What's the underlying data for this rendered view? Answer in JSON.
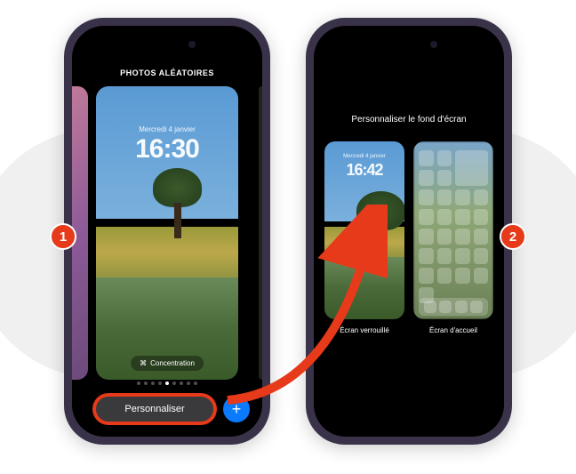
{
  "callouts": {
    "one": "1",
    "two": "2"
  },
  "phone1": {
    "header": "PHOTOS ALÉATOIRES",
    "lockscreen": {
      "date": "Mercredi 4 janvier",
      "time": "16:30"
    },
    "concentration_label": "Concentration",
    "customize_button": "Personnaliser",
    "add_button": "+"
  },
  "phone2": {
    "header": "Personnaliser le fond d'écran",
    "lockscreen": {
      "date": "Mercredi 4 janvier",
      "time": "16:42",
      "label": "Écran verrouillé"
    },
    "homescreen": {
      "label": "Écran d'accueil"
    }
  }
}
